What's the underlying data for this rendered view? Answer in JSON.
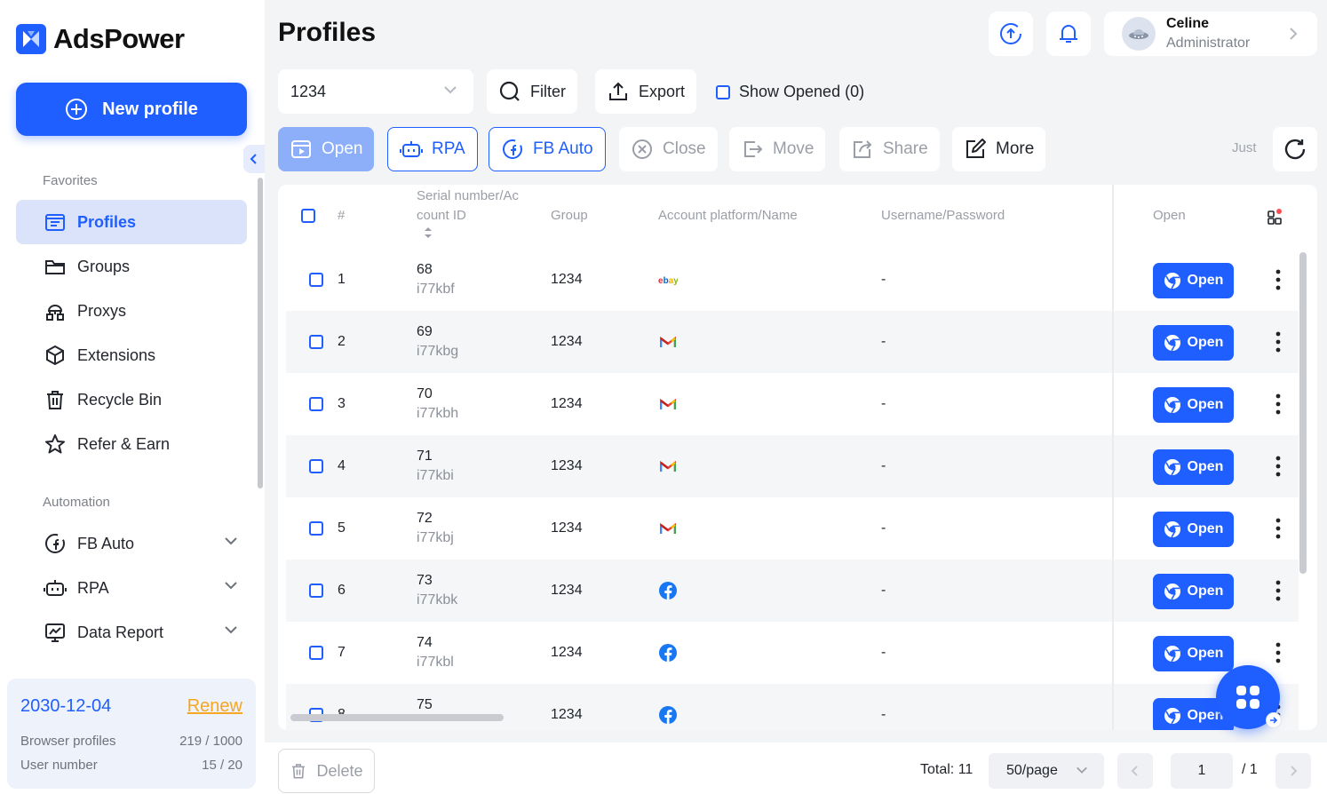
{
  "app": {
    "name": "AdsPower",
    "brand_color": "#1f5eff",
    "accent_color": "#f5a623"
  },
  "sidebar": {
    "new_profile_label": "New profile",
    "favorites_label": "Favorites",
    "automation_label": "Automation",
    "favorites": [
      {
        "label": "Profiles",
        "icon": "profiles-icon",
        "active": true
      },
      {
        "label": "Groups",
        "icon": "folder-icon"
      },
      {
        "label": "Proxys",
        "icon": "proxy-icon"
      },
      {
        "label": "Extensions",
        "icon": "cube-icon"
      },
      {
        "label": "Recycle Bin",
        "icon": "trash-icon"
      },
      {
        "label": "Refer & Earn",
        "icon": "star-icon"
      }
    ],
    "automation": [
      {
        "label": "FB Auto",
        "icon": "fb-auto-icon"
      },
      {
        "label": "RPA",
        "icon": "robot-icon"
      },
      {
        "label": "Data Report",
        "icon": "report-icon"
      }
    ]
  },
  "license": {
    "expiry": "2030-12-04",
    "renew_label": "Renew",
    "browser_profiles_label": "Browser profiles",
    "browser_profiles_value": "219 / 1000",
    "user_number_label": "User number",
    "user_number_value": "15 / 20"
  },
  "header": {
    "title": "Profiles",
    "user": {
      "name": "Celine",
      "role": "Administrator"
    }
  },
  "toolbar": {
    "group_select_value": "1234",
    "filter_label": "Filter",
    "export_label": "Export",
    "show_opened_label": "Show Opened (0)",
    "actions": {
      "open": "Open",
      "rpa": "RPA",
      "fb_auto": "FB Auto",
      "close": "Close",
      "move": "Move",
      "share": "Share",
      "more": "More"
    },
    "sync_status": "Just"
  },
  "table": {
    "columns": {
      "index": "#",
      "serial": "Serial number/Account ID",
      "group": "Group",
      "platform": "Account platform/Name",
      "credentials": "Username/Password",
      "open": "Open"
    },
    "open_button_label": "Open",
    "rows": [
      {
        "index": "1",
        "serial": "68",
        "account_id": "i77kbf",
        "group": "1234",
        "platform": "ebay",
        "credentials": "-"
      },
      {
        "index": "2",
        "serial": "69",
        "account_id": "i77kbg",
        "group": "1234",
        "platform": "gmail",
        "credentials": "-"
      },
      {
        "index": "3",
        "serial": "70",
        "account_id": "i77kbh",
        "group": "1234",
        "platform": "gmail",
        "credentials": "-"
      },
      {
        "index": "4",
        "serial": "71",
        "account_id": "i77kbi",
        "group": "1234",
        "platform": "gmail",
        "credentials": "-"
      },
      {
        "index": "5",
        "serial": "72",
        "account_id": "i77kbj",
        "group": "1234",
        "platform": "gmail",
        "credentials": "-"
      },
      {
        "index": "6",
        "serial": "73",
        "account_id": "i77kbk",
        "group": "1234",
        "platform": "facebook",
        "credentials": "-"
      },
      {
        "index": "7",
        "serial": "74",
        "account_id": "i77kbl",
        "group": "1234",
        "platform": "facebook",
        "credentials": "-"
      },
      {
        "index": "8",
        "serial": "75",
        "account_id": "",
        "group": "1234",
        "platform": "facebook",
        "credentials": "-"
      }
    ]
  },
  "footer": {
    "delete_label": "Delete",
    "total_label": "Total: 11",
    "per_page": "50/page",
    "current_page": "1",
    "total_pages": "/ 1"
  }
}
